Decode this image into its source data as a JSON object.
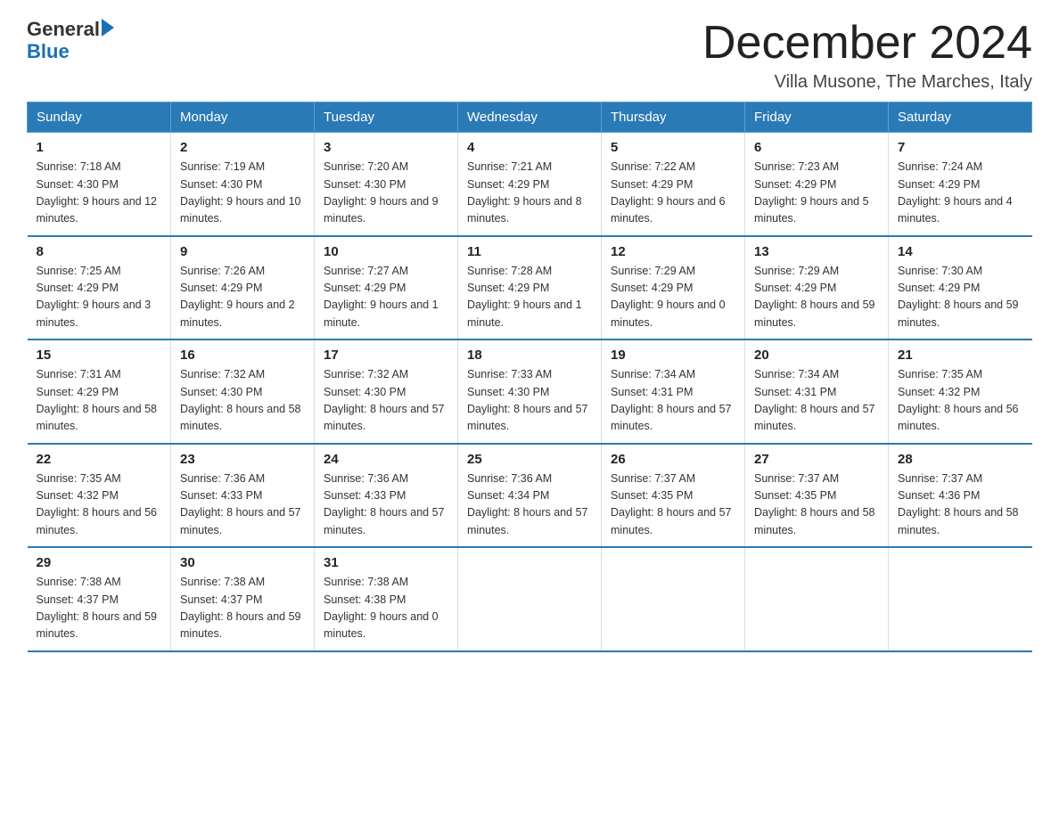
{
  "header": {
    "logo_general": "General",
    "logo_blue": "Blue",
    "month_title": "December 2024",
    "location": "Villa Musone, The Marches, Italy"
  },
  "weekdays": [
    "Sunday",
    "Monday",
    "Tuesday",
    "Wednesday",
    "Thursday",
    "Friday",
    "Saturday"
  ],
  "weeks": [
    [
      {
        "day": "1",
        "sunrise": "7:18 AM",
        "sunset": "4:30 PM",
        "daylight": "9 hours and 12 minutes."
      },
      {
        "day": "2",
        "sunrise": "7:19 AM",
        "sunset": "4:30 PM",
        "daylight": "9 hours and 10 minutes."
      },
      {
        "day": "3",
        "sunrise": "7:20 AM",
        "sunset": "4:30 PM",
        "daylight": "9 hours and 9 minutes."
      },
      {
        "day": "4",
        "sunrise": "7:21 AM",
        "sunset": "4:29 PM",
        "daylight": "9 hours and 8 minutes."
      },
      {
        "day": "5",
        "sunrise": "7:22 AM",
        "sunset": "4:29 PM",
        "daylight": "9 hours and 6 minutes."
      },
      {
        "day": "6",
        "sunrise": "7:23 AM",
        "sunset": "4:29 PM",
        "daylight": "9 hours and 5 minutes."
      },
      {
        "day": "7",
        "sunrise": "7:24 AM",
        "sunset": "4:29 PM",
        "daylight": "9 hours and 4 minutes."
      }
    ],
    [
      {
        "day": "8",
        "sunrise": "7:25 AM",
        "sunset": "4:29 PM",
        "daylight": "9 hours and 3 minutes."
      },
      {
        "day": "9",
        "sunrise": "7:26 AM",
        "sunset": "4:29 PM",
        "daylight": "9 hours and 2 minutes."
      },
      {
        "day": "10",
        "sunrise": "7:27 AM",
        "sunset": "4:29 PM",
        "daylight": "9 hours and 1 minute."
      },
      {
        "day": "11",
        "sunrise": "7:28 AM",
        "sunset": "4:29 PM",
        "daylight": "9 hours and 1 minute."
      },
      {
        "day": "12",
        "sunrise": "7:29 AM",
        "sunset": "4:29 PM",
        "daylight": "9 hours and 0 minutes."
      },
      {
        "day": "13",
        "sunrise": "7:29 AM",
        "sunset": "4:29 PM",
        "daylight": "8 hours and 59 minutes."
      },
      {
        "day": "14",
        "sunrise": "7:30 AM",
        "sunset": "4:29 PM",
        "daylight": "8 hours and 59 minutes."
      }
    ],
    [
      {
        "day": "15",
        "sunrise": "7:31 AM",
        "sunset": "4:29 PM",
        "daylight": "8 hours and 58 minutes."
      },
      {
        "day": "16",
        "sunrise": "7:32 AM",
        "sunset": "4:30 PM",
        "daylight": "8 hours and 58 minutes."
      },
      {
        "day": "17",
        "sunrise": "7:32 AM",
        "sunset": "4:30 PM",
        "daylight": "8 hours and 57 minutes."
      },
      {
        "day": "18",
        "sunrise": "7:33 AM",
        "sunset": "4:30 PM",
        "daylight": "8 hours and 57 minutes."
      },
      {
        "day": "19",
        "sunrise": "7:34 AM",
        "sunset": "4:31 PM",
        "daylight": "8 hours and 57 minutes."
      },
      {
        "day": "20",
        "sunrise": "7:34 AM",
        "sunset": "4:31 PM",
        "daylight": "8 hours and 57 minutes."
      },
      {
        "day": "21",
        "sunrise": "7:35 AM",
        "sunset": "4:32 PM",
        "daylight": "8 hours and 56 minutes."
      }
    ],
    [
      {
        "day": "22",
        "sunrise": "7:35 AM",
        "sunset": "4:32 PM",
        "daylight": "8 hours and 56 minutes."
      },
      {
        "day": "23",
        "sunrise": "7:36 AM",
        "sunset": "4:33 PM",
        "daylight": "8 hours and 57 minutes."
      },
      {
        "day": "24",
        "sunrise": "7:36 AM",
        "sunset": "4:33 PM",
        "daylight": "8 hours and 57 minutes."
      },
      {
        "day": "25",
        "sunrise": "7:36 AM",
        "sunset": "4:34 PM",
        "daylight": "8 hours and 57 minutes."
      },
      {
        "day": "26",
        "sunrise": "7:37 AM",
        "sunset": "4:35 PM",
        "daylight": "8 hours and 57 minutes."
      },
      {
        "day": "27",
        "sunrise": "7:37 AM",
        "sunset": "4:35 PM",
        "daylight": "8 hours and 58 minutes."
      },
      {
        "day": "28",
        "sunrise": "7:37 AM",
        "sunset": "4:36 PM",
        "daylight": "8 hours and 58 minutes."
      }
    ],
    [
      {
        "day": "29",
        "sunrise": "7:38 AM",
        "sunset": "4:37 PM",
        "daylight": "8 hours and 59 minutes."
      },
      {
        "day": "30",
        "sunrise": "7:38 AM",
        "sunset": "4:37 PM",
        "daylight": "8 hours and 59 minutes."
      },
      {
        "day": "31",
        "sunrise": "7:38 AM",
        "sunset": "4:38 PM",
        "daylight": "9 hours and 0 minutes."
      },
      null,
      null,
      null,
      null
    ]
  ],
  "labels": {
    "sunrise": "Sunrise:",
    "sunset": "Sunset:",
    "daylight": "Daylight:"
  }
}
